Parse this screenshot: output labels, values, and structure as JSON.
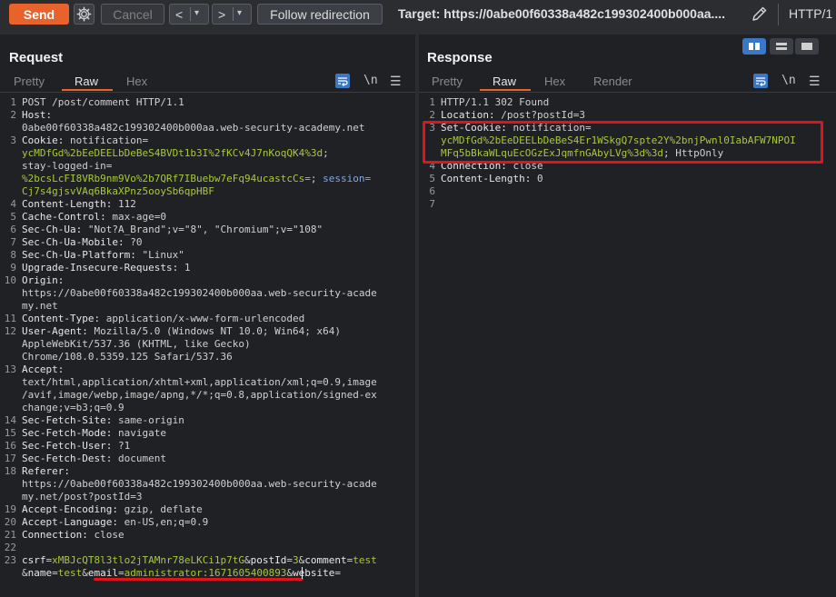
{
  "toolbar": {
    "send_label": "Send",
    "cancel_label": "Cancel",
    "back_label": "<",
    "forward_label": ">",
    "dropdown_glyph": "▾",
    "follow_label": "Follow redirection",
    "target_text": "Target: https://0abe00f60338a482c199302400b000aa....",
    "protocol": "HTTP/1",
    "gear_icon": "gear-icon",
    "pencil_icon": "pencil-icon"
  },
  "request": {
    "title": "Request",
    "tabs": [
      "Pretty",
      "Raw",
      "Hex"
    ],
    "active_tab": "Raw",
    "newline_toggle": "\\n",
    "lines": [
      {
        "n": "1",
        "parts": [
          [
            "POST /post/comment HTTP/1.1",
            "val"
          ]
        ]
      },
      {
        "n": "2",
        "parts": [
          [
            "Host:",
            "key"
          ]
        ]
      },
      {
        "n": "",
        "parts": [
          [
            "0abe00f60338a482c199302400b000aa.web-security-academy.net",
            "val"
          ]
        ]
      },
      {
        "n": "3",
        "parts": [
          [
            "Cookie: ",
            "key"
          ],
          [
            "notification=",
            "val"
          ]
        ]
      },
      {
        "n": "",
        "parts": [
          [
            "ycMDfGd%2bEeDEELbDeBeS4BVDt1b3I%2fKCv4J7nKoqQK4%3d",
            "cookie"
          ],
          [
            ";",
            "val"
          ]
        ]
      },
      {
        "n": "",
        "parts": [
          [
            "stay-logged-in=",
            "val"
          ]
        ]
      },
      {
        "n": "",
        "parts": [
          [
            "%2bcsLcFI8VRb9nm9Vo%2b7QRf7IBuebw7eFq94ucastcCs=",
            "cookie"
          ],
          [
            "; ",
            "val"
          ],
          [
            "session=",
            "blue"
          ]
        ]
      },
      {
        "n": "",
        "parts": [
          [
            "Cj7s4gjsvVAq6BkaXPnz5ooySb6qpHBF",
            "cookie"
          ]
        ]
      },
      {
        "n": "4",
        "parts": [
          [
            "Content-Length: ",
            "key"
          ],
          [
            "112",
            "val"
          ]
        ]
      },
      {
        "n": "5",
        "parts": [
          [
            "Cache-Control: ",
            "key"
          ],
          [
            "max-age=0",
            "val"
          ]
        ]
      },
      {
        "n": "6",
        "parts": [
          [
            "Sec-Ch-Ua: ",
            "key"
          ],
          [
            "\"Not?A_Brand\";v=\"8\", \"Chromium\";v=\"108\"",
            "val"
          ]
        ]
      },
      {
        "n": "7",
        "parts": [
          [
            "Sec-Ch-Ua-Mobile: ",
            "key"
          ],
          [
            "?0",
            "val"
          ]
        ]
      },
      {
        "n": "8",
        "parts": [
          [
            "Sec-Ch-Ua-Platform: ",
            "key"
          ],
          [
            "\"Linux\"",
            "val"
          ]
        ]
      },
      {
        "n": "9",
        "parts": [
          [
            "Upgrade-Insecure-Requests: ",
            "key"
          ],
          [
            "1",
            "val"
          ]
        ]
      },
      {
        "n": "10",
        "parts": [
          [
            "Origin:",
            "key"
          ]
        ]
      },
      {
        "n": "",
        "parts": [
          [
            "https://0abe00f60338a482c199302400b000aa.web-security-acade",
            "val"
          ]
        ]
      },
      {
        "n": "",
        "parts": [
          [
            "my.net",
            "val"
          ]
        ]
      },
      {
        "n": "11",
        "parts": [
          [
            "Content-Type: ",
            "key"
          ],
          [
            "application/x-www-form-urlencoded",
            "val"
          ]
        ]
      },
      {
        "n": "12",
        "parts": [
          [
            "User-Agent: ",
            "key"
          ],
          [
            "Mozilla/5.0 (Windows NT 10.0; Win64; x64)",
            "val"
          ]
        ]
      },
      {
        "n": "",
        "parts": [
          [
            "AppleWebKit/537.36 (KHTML, like Gecko)",
            "val"
          ]
        ]
      },
      {
        "n": "",
        "parts": [
          [
            "Chrome/108.0.5359.125 Safari/537.36",
            "val"
          ]
        ]
      },
      {
        "n": "13",
        "parts": [
          [
            "Accept:",
            "key"
          ]
        ]
      },
      {
        "n": "",
        "parts": [
          [
            "text/html,application/xhtml+xml,application/xml;q=0.9,image",
            "val"
          ]
        ]
      },
      {
        "n": "",
        "parts": [
          [
            "/avif,image/webp,image/apng,*/*;q=0.8,application/signed-ex",
            "val"
          ]
        ]
      },
      {
        "n": "",
        "parts": [
          [
            "change;v=b3;q=0.9",
            "val"
          ]
        ]
      },
      {
        "n": "14",
        "parts": [
          [
            "Sec-Fetch-Site: ",
            "key"
          ],
          [
            "same-origin",
            "val"
          ]
        ]
      },
      {
        "n": "15",
        "parts": [
          [
            "Sec-Fetch-Mode: ",
            "key"
          ],
          [
            "navigate",
            "val"
          ]
        ]
      },
      {
        "n": "16",
        "parts": [
          [
            "Sec-Fetch-User: ",
            "key"
          ],
          [
            "?1",
            "val"
          ]
        ]
      },
      {
        "n": "17",
        "parts": [
          [
            "Sec-Fetch-Dest: ",
            "key"
          ],
          [
            "document",
            "val"
          ]
        ]
      },
      {
        "n": "18",
        "parts": [
          [
            "Referer:",
            "key"
          ]
        ]
      },
      {
        "n": "",
        "parts": [
          [
            "https://0abe00f60338a482c199302400b000aa.web-security-acade",
            "val"
          ]
        ]
      },
      {
        "n": "",
        "parts": [
          [
            "my.net/post?postId=3",
            "val"
          ]
        ]
      },
      {
        "n": "19",
        "parts": [
          [
            "Accept-Encoding: ",
            "key"
          ],
          [
            "gzip, deflate",
            "val"
          ]
        ]
      },
      {
        "n": "20",
        "parts": [
          [
            "Accept-Language: ",
            "key"
          ],
          [
            "en-US,en;q=0.9",
            "val"
          ]
        ]
      },
      {
        "n": "21",
        "parts": [
          [
            "Connection: ",
            "key"
          ],
          [
            "close",
            "val"
          ]
        ]
      },
      {
        "n": "22",
        "parts": []
      },
      {
        "n": "23",
        "parts": [
          [
            "csrf",
            "param"
          ],
          [
            "=",
            "val"
          ],
          [
            "xMBJcQT8l3tlo2jTAMnr78eLKCi1p7tG",
            "pval"
          ],
          [
            "&",
            "val"
          ],
          [
            "postId",
            "param"
          ],
          [
            "=",
            "val"
          ],
          [
            "3",
            "pval"
          ],
          [
            "&",
            "val"
          ],
          [
            "comment",
            "param"
          ],
          [
            "=",
            "val"
          ],
          [
            "test",
            "pval"
          ]
        ]
      },
      {
        "n": "",
        "parts": [
          [
            "&",
            "val"
          ],
          [
            "name",
            "param"
          ],
          [
            "=",
            "val"
          ],
          [
            "test",
            "pval"
          ],
          [
            "&",
            "val"
          ],
          [
            "email",
            "param"
          ],
          [
            "=",
            "val"
          ],
          [
            "administrator:1671605400893",
            "pval"
          ],
          [
            "&",
            "val"
          ],
          [
            "website",
            "param"
          ],
          [
            "=",
            "val"
          ]
        ]
      }
    ]
  },
  "response": {
    "title": "Response",
    "tabs": [
      "Pretty",
      "Raw",
      "Hex",
      "Render"
    ],
    "active_tab": "Raw",
    "newline_toggle": "\\n",
    "lines": [
      {
        "n": "1",
        "parts": [
          [
            "HTTP/1.1 302 Found",
            "val"
          ]
        ]
      },
      {
        "n": "2",
        "parts": [
          [
            "Location: ",
            "key"
          ],
          [
            "/post?postId=3",
            "val"
          ]
        ]
      },
      {
        "n": "3",
        "parts": [
          [
            "Set-Cookie: ",
            "key"
          ],
          [
            "notification=",
            "val"
          ]
        ]
      },
      {
        "n": "",
        "parts": [
          [
            "ycMDfGd%2bEeDEELbDeBeS4Er1WSkgQ7spte2Y%2bnjPwnl0IabAFW7NPOI",
            "cookie"
          ]
        ]
      },
      {
        "n": "",
        "parts": [
          [
            "MFq5bBkaWLquEcOGzExJqmfnGAbyLVg%3d%3d",
            "cookie"
          ],
          [
            "; HttpOnly",
            "val"
          ]
        ]
      },
      {
        "n": "4",
        "parts": [
          [
            "Connection: ",
            "key"
          ],
          [
            "close",
            "val"
          ]
        ]
      },
      {
        "n": "5",
        "parts": [
          [
            "Content-Length: ",
            "key"
          ],
          [
            "0",
            "val"
          ]
        ]
      },
      {
        "n": "6",
        "parts": []
      },
      {
        "n": "7",
        "parts": []
      }
    ]
  },
  "colors": {
    "accent": "#e8632c",
    "highlight": "#e0141a",
    "cookie_value": "#a8c73c",
    "active_toggle": "#3a78c7"
  }
}
